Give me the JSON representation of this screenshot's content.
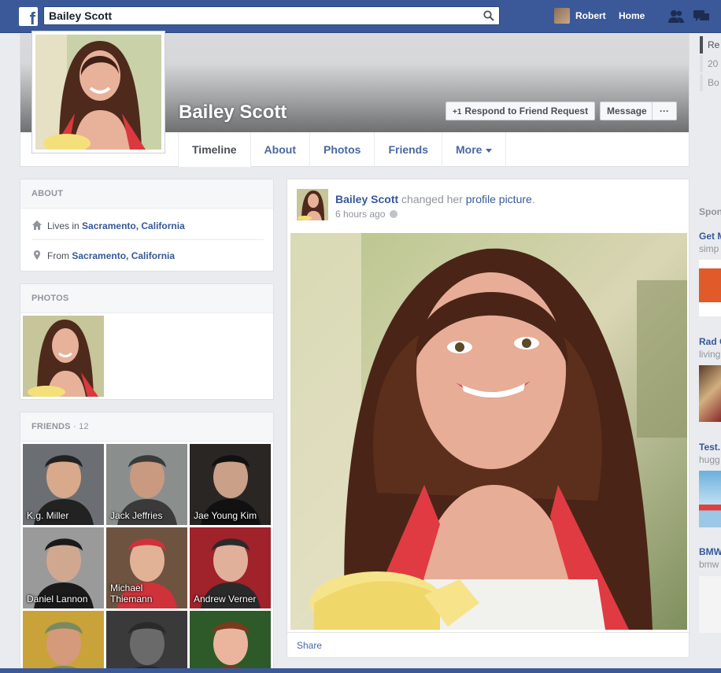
{
  "topbar": {
    "search_value": "Bailey Scott",
    "user_name": "Robert",
    "home_label": "Home"
  },
  "profile": {
    "name": "Bailey Scott",
    "respond_label": "Respond to Friend Request",
    "message_label": "Message",
    "more_dots": "···",
    "tabs": [
      "Timeline",
      "About",
      "Photos",
      "Friends",
      "More"
    ]
  },
  "about": {
    "header": "ABOUT",
    "lives_prefix": "Lives in ",
    "lives_place": "Sacramento, California",
    "from_prefix": "From ",
    "from_place": "Sacramento, California"
  },
  "photos": {
    "header": "PHOTOS"
  },
  "friends": {
    "header": "FRIENDS",
    "count": "· 12",
    "list": [
      {
        "name": "K.g. Miller"
      },
      {
        "name": "Jack Jeffries"
      },
      {
        "name": "Jae Young Kim"
      },
      {
        "name": "Daniel Lannon"
      },
      {
        "name": "Michael Thiemann"
      },
      {
        "name": "Andrew Verner"
      },
      {
        "name": ""
      },
      {
        "name": ""
      },
      {
        "name": ""
      }
    ]
  },
  "post": {
    "author": "Bailey Scott",
    "action_text": " changed her ",
    "action_link": "profile picture",
    "action_end": ".",
    "time": "6 hours ago",
    "share_label": "Share"
  },
  "rail": {
    "items": [
      "Re",
      "20",
      "Bo"
    ],
    "sponsored": "Spon",
    "ads": [
      {
        "title": "Get M",
        "sub": "simp"
      },
      {
        "title": "Rad C",
        "sub": "living"
      },
      {
        "title": "Test.",
        "sub": "hugg"
      },
      {
        "title": "BMW",
        "sub": "bmw"
      }
    ]
  },
  "colors": {
    "brand": "#3b5998",
    "link": "#365899"
  }
}
